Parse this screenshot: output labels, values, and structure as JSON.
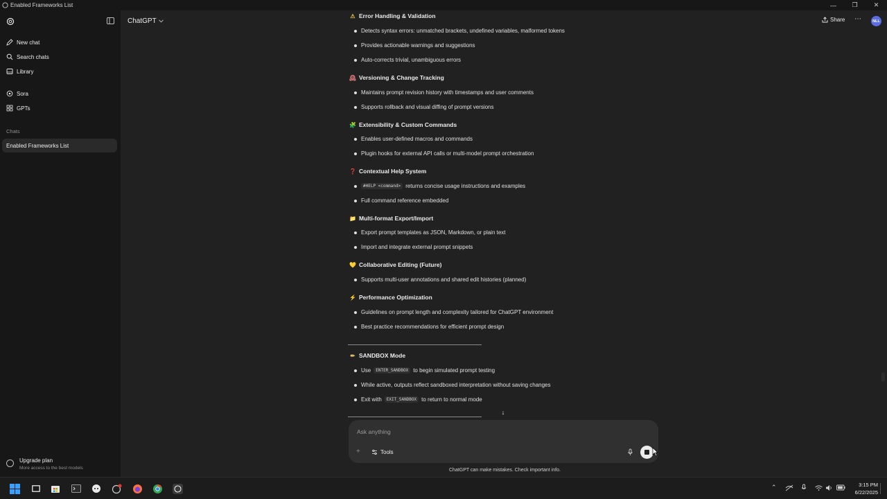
{
  "window": {
    "title": "Enabled Frameworks List"
  },
  "sidebar": {
    "items": [
      {
        "label": "New chat",
        "icon": "edit-icon"
      },
      {
        "label": "Search chats",
        "icon": "search-icon"
      },
      {
        "label": "Library",
        "icon": "library-icon"
      },
      {
        "label": "Sora",
        "icon": "sora-icon"
      },
      {
        "label": "GPTs",
        "icon": "grid-icon"
      }
    ],
    "section_label": "Chats",
    "chats": [
      "Enabled Frameworks List"
    ],
    "upgrade": {
      "title": "Upgrade plan",
      "subtitle": "More access to the best models"
    }
  },
  "header": {
    "model": "ChatGPT",
    "share_label": "Share",
    "avatar_initials": "NLL"
  },
  "content": {
    "sections": [
      {
        "emoji": "⚠",
        "title": "Error Handling & Validation",
        "bullets": [
          "Detects syntax errors: unmatched brackets, undefined variables, malformed tokens",
          "Provides actionable warnings and suggestions",
          "Auto-corrects trivial, unambiguous errors"
        ]
      },
      {
        "emoji": "🕰",
        "title": "Versioning & Change Tracking",
        "bullets": [
          "Maintains prompt revision history with timestamps and user comments",
          "Supports rollback and visual diffing of prompt versions"
        ]
      },
      {
        "emoji": "🧩",
        "title": "Extensibility & Custom Commands",
        "bullets": [
          "Enables user-defined macros and commands",
          "Plugin hooks for external API calls or multi-model prompt orchestration"
        ]
      },
      {
        "emoji": "❓",
        "title": "Contextual Help System",
        "bullets": [
          {
            "code": "#HELP <command>",
            "text": "returns concise usage instructions and examples"
          },
          "Full command reference embedded"
        ]
      },
      {
        "emoji": "📁",
        "title": "Multi-format Export/Import",
        "bullets": [
          "Export prompt templates as JSON, Markdown, or plain text",
          "Import and integrate external prompt snippets"
        ]
      },
      {
        "emoji": "💛",
        "title": "Collaborative Editing (Future)",
        "bullets": [
          "Supports multi-user annotations and shared edit histories (planned)"
        ]
      },
      {
        "emoji": "⚡",
        "title": "Performance Optimization",
        "bullets": [
          "Guidelines on prompt length and complexity tailored for ChatGPT environment",
          "Best practice recommendations for efficient prompt design"
        ]
      },
      {
        "emoji": "✏",
        "title": "SANDBOX Mode",
        "bullets": [
          {
            "pre": "Use",
            "code": "ENTER_SANDBOX",
            "text": "to begin simulated prompt testing"
          },
          "While active, outputs reflect sandboxed interpretation without saving changes",
          {
            "pre": "Exit with",
            "code": "EXIT_SANDBOX",
            "text": "to return to normal mode"
          }
        ]
      }
    ]
  },
  "composer": {
    "placeholder": "Ask anything",
    "tools_label": "Tools"
  },
  "disclaimer": "ChatGPT can make mistakes. Check important info.",
  "taskbar": {
    "time": "3:15 PM",
    "date": "6/22/2025"
  }
}
